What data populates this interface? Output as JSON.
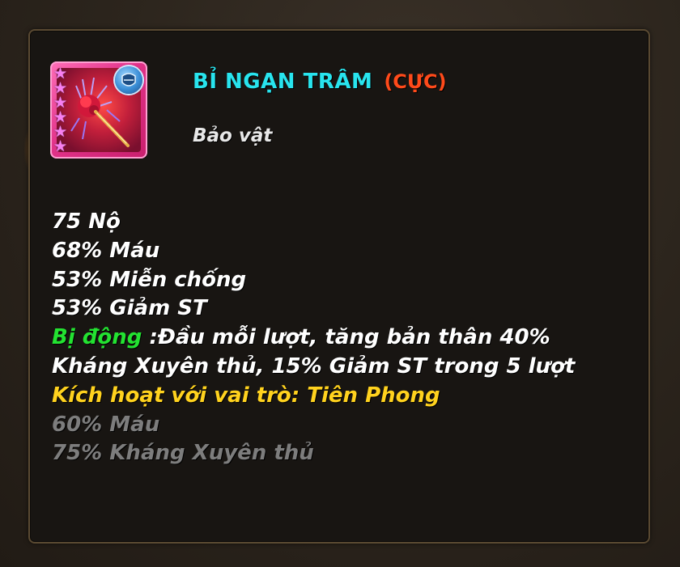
{
  "item": {
    "name": "BỈ NGẠN TRÂM",
    "rarity": "(CỰC)",
    "type": "Bảo vật",
    "stars": 6,
    "star_glyph": "★",
    "icon": "red-spider-lily-hairpin-icon",
    "role_icon": "shield-helmet-icon"
  },
  "stats": [
    "75 Nộ",
    "68% Máu",
    "53% Miễn chống",
    "53% Giảm ST"
  ],
  "passive": {
    "label": "Bị động",
    "line1": " :Đầu mỗi lượt, tăng bản thân 40%",
    "line2": "Kháng Xuyên thủ, 15% Giảm ST trong 5 lượt"
  },
  "activation": {
    "header": "Kích hoạt với vai trò: Tiên Phong",
    "bonuses": [
      "60% Máu",
      "75% Kháng Xuyên thủ"
    ]
  },
  "colors": {
    "title": "#28e4ee",
    "rarity": "#ff4a1a",
    "passive_label": "#23e231",
    "activation": "#ffd21e",
    "inactive": "#7d7d7d",
    "icon_frame": "#e2338a"
  }
}
